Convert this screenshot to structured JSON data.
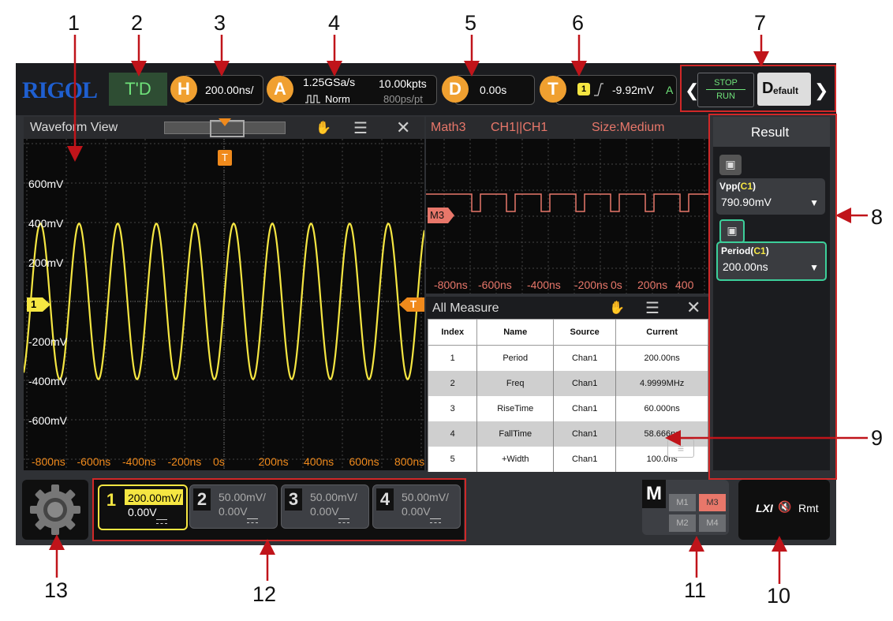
{
  "callouts": [
    "1",
    "2",
    "3",
    "4",
    "5",
    "6",
    "7",
    "8",
    "9",
    "10",
    "11",
    "12",
    "13"
  ],
  "brand": "RIGOL",
  "top": {
    "mode": "T'D",
    "h_label": "H",
    "h_value": "200.00ns/",
    "a_label": "A",
    "a_rate": "1.25GSa/s",
    "a_mode": "Norm",
    "a_pts": "10.00kpts",
    "a_res": "800ps/pt",
    "d_label": "D",
    "d_value": "0.00s",
    "t_label": "T",
    "t_ch": "1",
    "t_level": "-9.92mV",
    "t_a": "A",
    "stop": "STOP",
    "run": "RUN",
    "default_big": "D",
    "default_small": "efault"
  },
  "waveform": {
    "title": "Waveform View",
    "y_labels": [
      "600mV",
      "400mV",
      "200mV",
      "-200mV",
      "-400mV",
      "-600mV"
    ],
    "x_labels": [
      "-800ns",
      "-600ns",
      "-400ns",
      "-200ns",
      "0s",
      "200ns",
      "400ns",
      "600ns",
      "800ns"
    ],
    "ch_marker": "1",
    "trig_marker": "T"
  },
  "math": {
    "title_a": "Math3",
    "title_b": "CH1||CH1",
    "title_c": "Size:Medium",
    "marker": "M3",
    "x_labels": [
      "-800ns",
      "-600ns",
      "-400ns",
      "-200ns",
      "0s",
      "200ns",
      "400"
    ]
  },
  "all_measure": {
    "title": "All Measure",
    "headers": [
      "Index",
      "Name",
      "Source",
      "Current"
    ],
    "rows": [
      [
        "1",
        "Period",
        "Chan1",
        "200.00ns"
      ],
      [
        "2",
        "Freq",
        "Chan1",
        "4.9999MHz"
      ],
      [
        "3",
        "RiseTime",
        "Chan1",
        "60.000ns"
      ],
      [
        "4",
        "FallTime",
        "Chan1",
        "58.666ns"
      ],
      [
        "5",
        "+Width",
        "Chan1",
        "100.0ns"
      ]
    ]
  },
  "result": {
    "title": "Result",
    "items": [
      {
        "name": "Vpp(",
        "ch": "C1",
        "close": ")",
        "value": "790.90mV"
      },
      {
        "name": "Period(",
        "ch": "C1",
        "close": ")",
        "value": "200.00ns"
      }
    ]
  },
  "channels": [
    {
      "num": "1",
      "scale": "200.00mV/",
      "offset": "0.00V",
      "active": true
    },
    {
      "num": "2",
      "scale": "50.00mV/",
      "offset": "0.00V",
      "active": false
    },
    {
      "num": "3",
      "scale": "50.00mV/",
      "offset": "0.00V",
      "active": false
    },
    {
      "num": "4",
      "scale": "50.00mV/",
      "offset": "0.00V",
      "active": false
    }
  ],
  "math_btn": {
    "label": "M",
    "m1": "M1",
    "m2": "M2",
    "m3": "M3",
    "m4": "M4"
  },
  "status": {
    "lxi": "LXI",
    "rmt": "Rmt"
  },
  "colors": {
    "ch1": "#f5e642",
    "trigger": "#f08a1c",
    "math": "#e8776a",
    "accent_red": "#d02828"
  }
}
